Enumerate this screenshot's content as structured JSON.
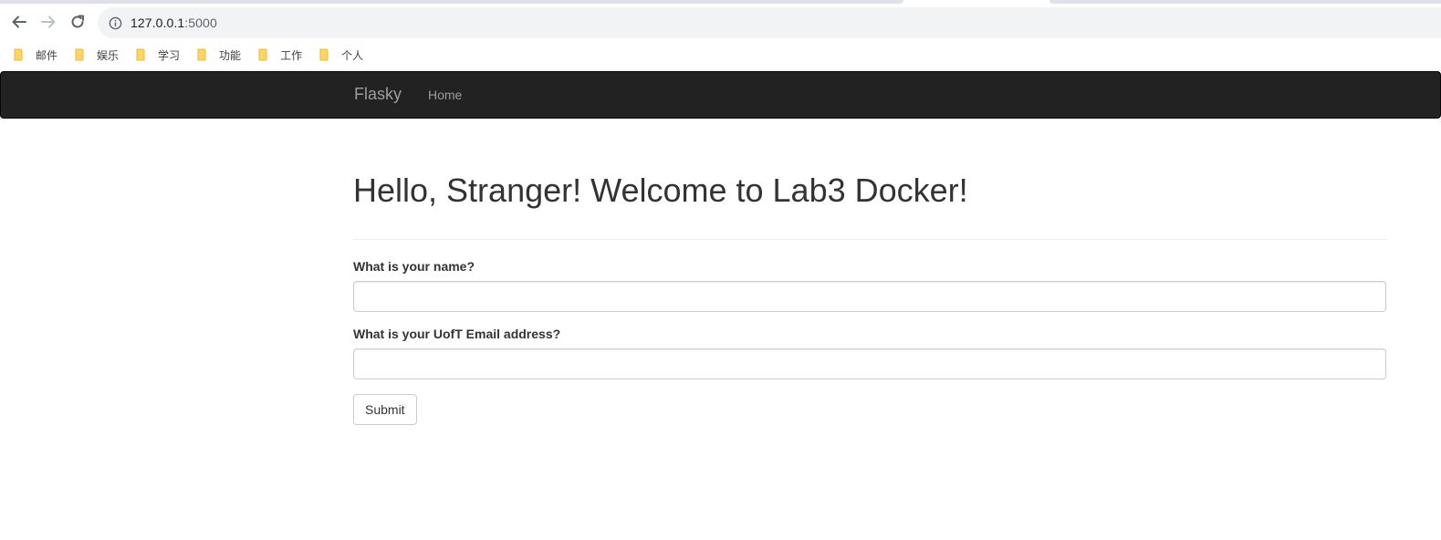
{
  "browser": {
    "url_host": "127.0.0.1",
    "url_port": ":5000",
    "bookmarks": [
      {
        "label": "邮件",
        "icon": "folder-icon"
      },
      {
        "label": "娱乐",
        "icon": "folder-icon"
      },
      {
        "label": "学习",
        "icon": "folder-icon"
      },
      {
        "label": "功能",
        "icon": "folder-icon"
      },
      {
        "label": "工作",
        "icon": "folder-icon"
      },
      {
        "label": "个人",
        "icon": "folder-icon"
      }
    ],
    "icons": {
      "back": "back-arrow-icon",
      "forward": "forward-arrow-icon",
      "reload": "reload-icon",
      "info": "info-icon"
    }
  },
  "navbar": {
    "brand": "Flasky",
    "home": "Home",
    "background": "#222222",
    "text_color": "#9d9d9d"
  },
  "page": {
    "heading": "Hello, Stranger! Welcome to Lab3 Docker!"
  },
  "form": {
    "name_label": "What is your name?",
    "name_value": "",
    "email_label": "What is your UofT Email address?",
    "email_value": "",
    "submit_label": "Submit"
  }
}
